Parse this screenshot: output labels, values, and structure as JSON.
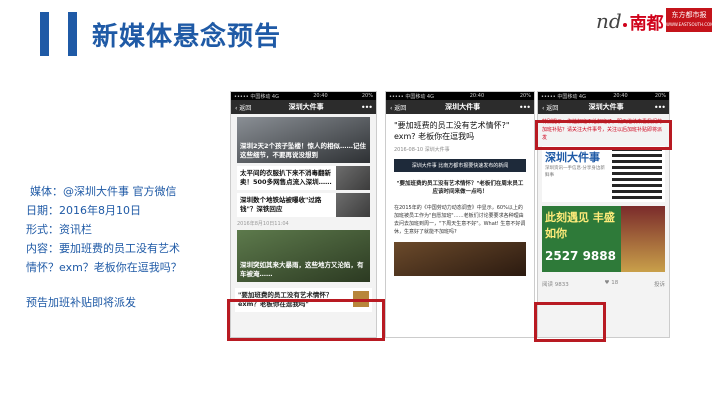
{
  "slide": {
    "title": "新媒体悬念预告",
    "logo_nd": "nd",
    "logo_cn": "南都",
    "logo_badge": "东方都市报",
    "logo_badge_sub": "WWW.EASTSOUTH.COM"
  },
  "meta": {
    "media": "媒体：@深圳大件事 官方微信",
    "date": "日期：2016年8月10日",
    "form": "形式：资讯栏",
    "content_1": "内容：要加班费的员工没有艺术",
    "content_2": "情怀？exm？老板你在逗我吗？",
    "note": "预告加班补贴即将派发"
  },
  "phone1": {
    "status_left": "••••• 中国移动 4G",
    "status_mid": "20:40",
    "status_right": "20%",
    "nav_back": "‹ 返回",
    "nav_title": "深圳大件事",
    "nav_more": "•••",
    "card1_caption": "深圳2天2个孩子坠楼！惊人的相似……记住这些细节，不要再说没想到",
    "item1": "太平间的衣服扒下来不消毒翻新卖！500多网售点流入深圳……",
    "item2": "深圳数个地铁站被曝收\"过路钱\"？深铁回应",
    "date_sep": "2016年8月10日11:04",
    "card2_caption": "深圳突如其来大暴雨，这些地方又沦陷，有车被淹……",
    "hilite": "\"要加班费的员工没有艺术情怀？exm？老板你在逗我吗\""
  },
  "phone2": {
    "status_left": "••••• 中国移动 4G",
    "status_mid": "20:40",
    "status_right": "20%",
    "nav_back": "‹ 返回",
    "nav_title": "深圳大件事",
    "nav_more": "•••",
    "title": "\"要加班费的员工没有艺术情怀?\" exm? 老板你在逗我吗",
    "meta": "2016-08-10 深圳大件事",
    "sub": "深圳大件事    比南方都市报要快速发布的新闻",
    "quote": "\"要加班费的员工没有艺术情怀？\"老板们在周末员工应该时间来做一点吗！",
    "body": "在2015年的《中国劳动力动态调查》中显示，60%以上的加班被员工作为\"自愿加班\"……老板们讨论要要求各种理由去问去加班到周一，\"下周天生意不好\"。What! 生意不好调休，生意好了就能不加班吗?"
  },
  "phone3": {
    "status_left": "••••• 中国移动 4G",
    "status_mid": "20:40",
    "status_right": "20%",
    "nav_back": "‹ 返回",
    "nav_title": "深圳大件事",
    "nav_more": "•••",
    "warn": "特别提示：你拉加班不给加班了，明天继续来看我们的加班补贴？请关注大件事号，关注以后加班补贴即将派发",
    "ad1_big": "深圳大件事",
    "ad1_small": "深圳资讯一手信息·分享身边新鲜事",
    "ad2_big": "此刻遇见 丰盛如你",
    "ad2_phone": "2527 9888",
    "read_label": "阅读 9833",
    "like_label": "♥ 18",
    "report_label": "投诉"
  }
}
